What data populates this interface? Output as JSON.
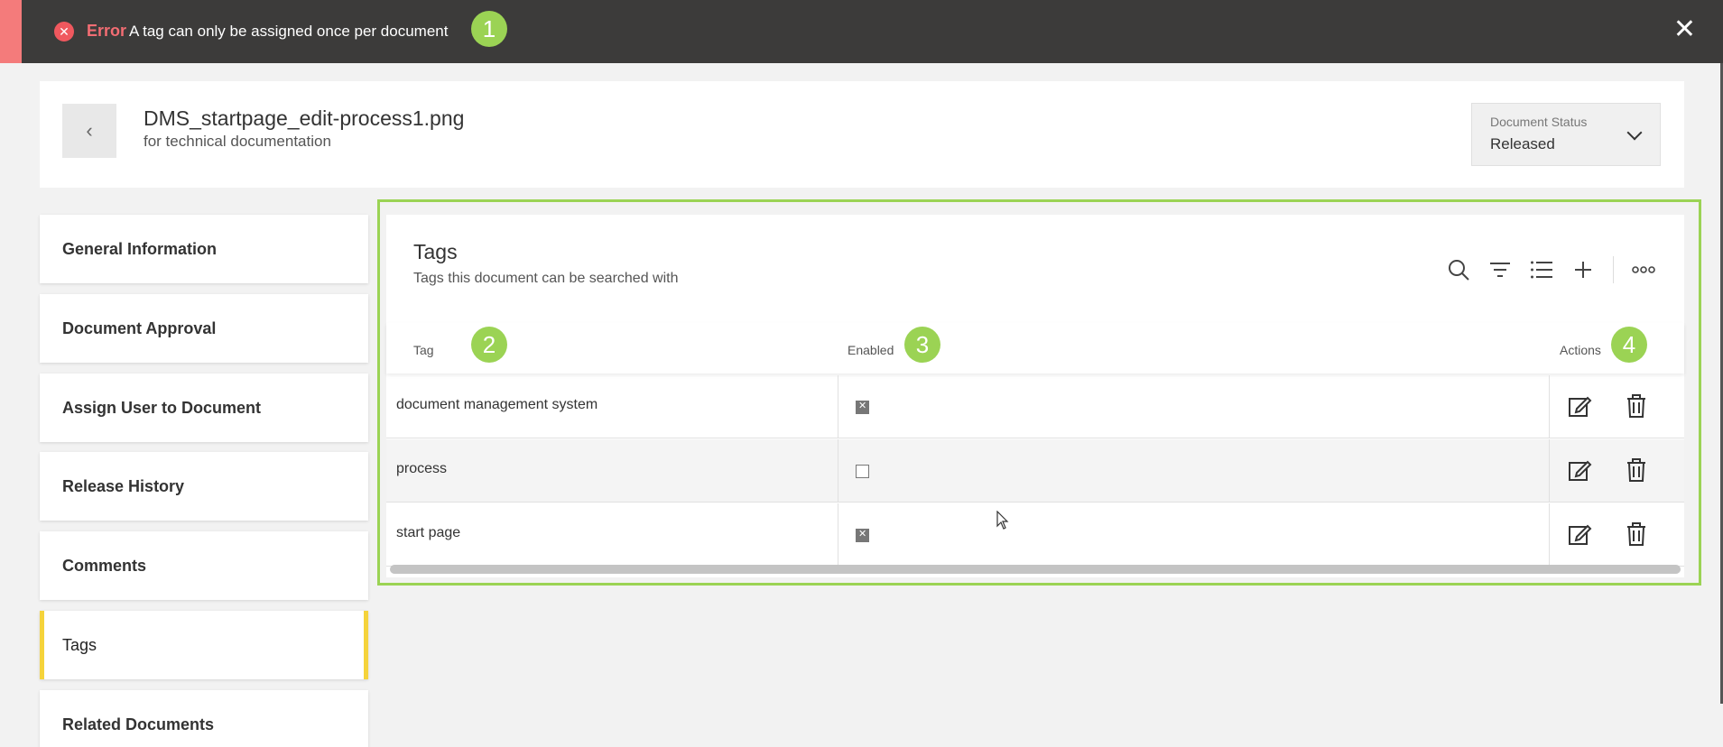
{
  "banner": {
    "label": "Error",
    "message": "A tag can only be assigned once per document",
    "close_icon": "close-icon"
  },
  "markers": {
    "m1": "1",
    "m2": "2",
    "m3": "3",
    "m4": "4"
  },
  "header": {
    "back_glyph": "‹",
    "title": "DMS_startpage_edit-process1.png",
    "subtitle": "for technical documentation",
    "status_label": "Document Status",
    "status_value": "Released"
  },
  "sidebar": {
    "items": [
      {
        "label": "General Information"
      },
      {
        "label": "Document Approval"
      },
      {
        "label": "Assign User to Document"
      },
      {
        "label": "Release History"
      },
      {
        "label": "Comments"
      },
      {
        "label": "Tags"
      },
      {
        "label": "Related Documents"
      }
    ],
    "active": "Tags"
  },
  "panel": {
    "title": "Tags",
    "subtitle": "Tags this document can be searched with",
    "columns": {
      "tag": "Tag",
      "enabled": "Enabled",
      "actions": "Actions"
    },
    "rows": [
      {
        "tag": "document management system",
        "enabled": true
      },
      {
        "tag": "process",
        "enabled": false
      },
      {
        "tag": "start page",
        "enabled": true
      }
    ]
  },
  "colors": {
    "accent": "#9bd354",
    "error": "#f36d73",
    "active": "#f5d33b",
    "banner_bg": "#3c3b3a"
  }
}
